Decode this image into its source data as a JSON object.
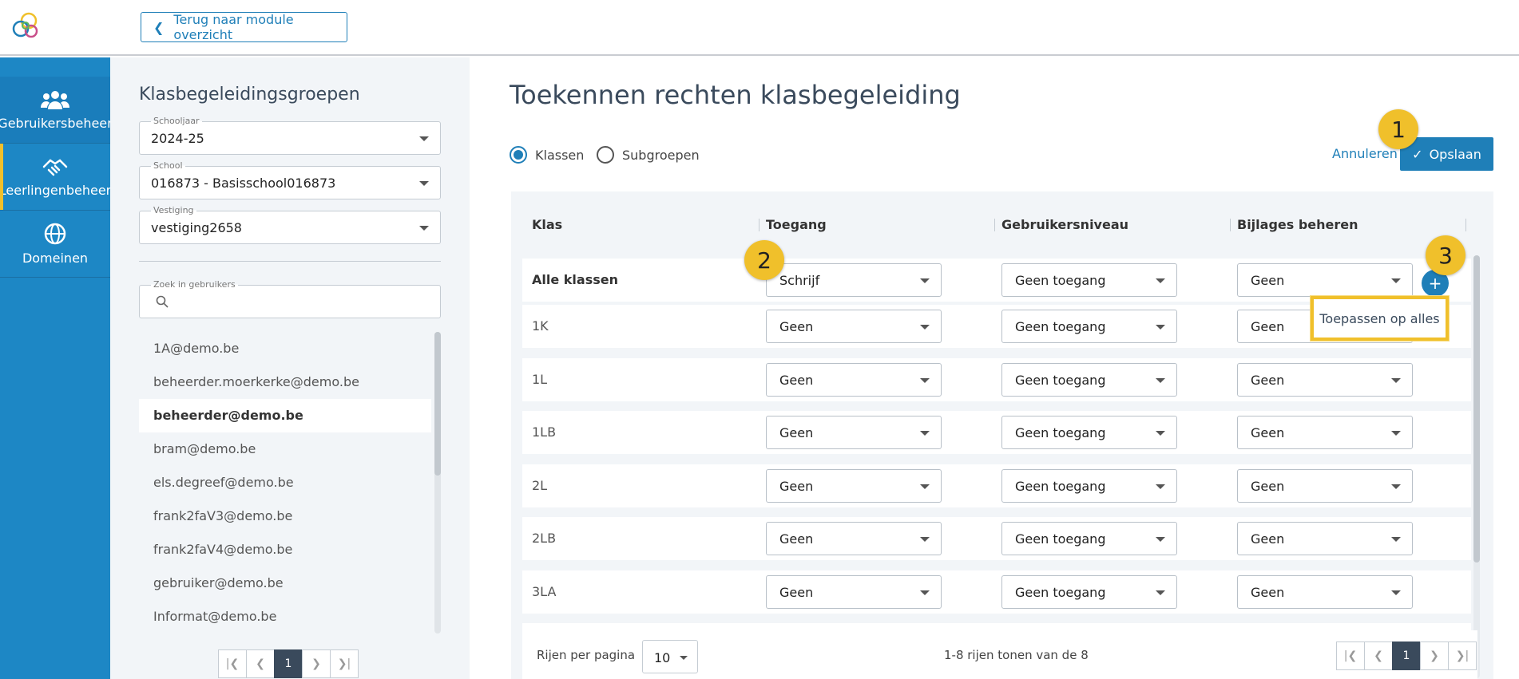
{
  "header": {
    "back_label": "Terug naar module overzicht"
  },
  "nav": {
    "items": [
      {
        "label": "Gebruikersbeheer",
        "icon": "users-icon"
      },
      {
        "label": "Leerlingenbeheer",
        "icon": "handshake-icon"
      },
      {
        "label": "Domeinen",
        "icon": "globe-icon"
      }
    ],
    "active": "Leerlingenbeheer"
  },
  "sidebar": {
    "title": "Klasbegeleidingsgroepen",
    "filters": [
      {
        "label": "Schooljaar",
        "value": "2024-25"
      },
      {
        "label": "School",
        "value": "016873 - Basisschool016873"
      },
      {
        "label": "Vestiging",
        "value": "vestiging2658"
      }
    ],
    "search": {
      "label": "Zoek in gebruikers",
      "value": ""
    },
    "users": [
      "1A@demo.be",
      "beheerder.moerkerke@demo.be",
      "beheerder@demo.be",
      "bram@demo.be",
      "els.degreef@demo.be",
      "frank2faV3@demo.be",
      "frank2faV4@demo.be",
      "gebruiker@demo.be",
      "Informat@demo.be"
    ],
    "selected_user": "beheerder@demo.be",
    "pager": {
      "current": "1"
    }
  },
  "main": {
    "title": "Toekennen rechten klasbegeleiding",
    "radio": {
      "option1": "Klassen",
      "option2": "Subgroepen",
      "selected": "Klassen"
    },
    "cancel_label": "Annuleren",
    "save_label": "Opslaan",
    "table": {
      "columns": [
        "Klas",
        "Toegang",
        "Gebruikersniveau",
        "Bijlages beheren"
      ],
      "rows": [
        {
          "klas": "Alle klassen",
          "toegang": "Schrijf",
          "niveau": "Geen toegang",
          "bijlages": "Geen"
        },
        {
          "klas": "1K",
          "toegang": "Geen",
          "niveau": "Geen toegang",
          "bijlages": "Geen"
        },
        {
          "klas": "1L",
          "toegang": "Geen",
          "niveau": "Geen toegang",
          "bijlages": "Geen"
        },
        {
          "klas": "1LB",
          "toegang": "Geen",
          "niveau": "Geen toegang",
          "bijlages": "Geen"
        },
        {
          "klas": "2L",
          "toegang": "Geen",
          "niveau": "Geen toegang",
          "bijlages": "Geen"
        },
        {
          "klas": "2LB",
          "toegang": "Geen",
          "niveau": "Geen toegang",
          "bijlages": "Geen"
        },
        {
          "klas": "3LA",
          "toegang": "Geen",
          "niveau": "Geen toegang",
          "bijlages": "Geen"
        }
      ]
    },
    "apply_all_label": "Toepassen op alles",
    "footer": {
      "rows_per_page_label": "Rijen per pagina",
      "rows_per_page_value": "10",
      "range_text": "1-8 rijen tonen van de 8",
      "current_page": "1"
    }
  },
  "badges": [
    "1",
    "2",
    "3"
  ],
  "colors": {
    "accent": "#1f7fb8",
    "nav_bg": "#1d87c5",
    "badge": "#f0c02b"
  }
}
